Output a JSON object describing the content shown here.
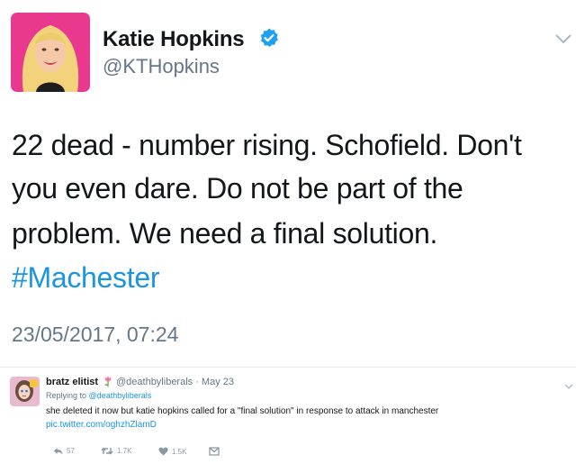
{
  "tweet": {
    "author_name": "Katie Hopkins",
    "handle": "@KTHopkins",
    "text_lines": [
      "22 dead - number rising. Schofield. Don't",
      "you even dare. Do not be part of the",
      "problem. We need a final solution.",
      "#Machester"
    ],
    "timestamp": "23/05/2017, 07:24",
    "icons": {
      "verified": "verified-badge-icon",
      "menu": "chevron-down-icon"
    },
    "colors": {
      "hashtag": "#1b95e0",
      "verified": "#1da1f2",
      "avatar_bg": "#e8398f"
    }
  },
  "reply": {
    "author_name": "bratz elitist",
    "handle_date": "@deathbyliberals · May 23",
    "replying_prefix": "Replying to",
    "replying_handle": "@deathbyliberals",
    "text": "she deleted it now but katie hopkins called for a \"final solution\" in response to attack in manchester",
    "link": "pic.twitter.com/oghzhZlamD",
    "actions": {
      "reply_count": "57",
      "retweet_count": "1.7K",
      "like_count": "1.5K"
    },
    "icons": {
      "name_emoji": "flower-icon",
      "reply": "reply-icon",
      "retweet": "retweet-icon",
      "like": "heart-icon",
      "dm": "direct-message-icon"
    }
  }
}
